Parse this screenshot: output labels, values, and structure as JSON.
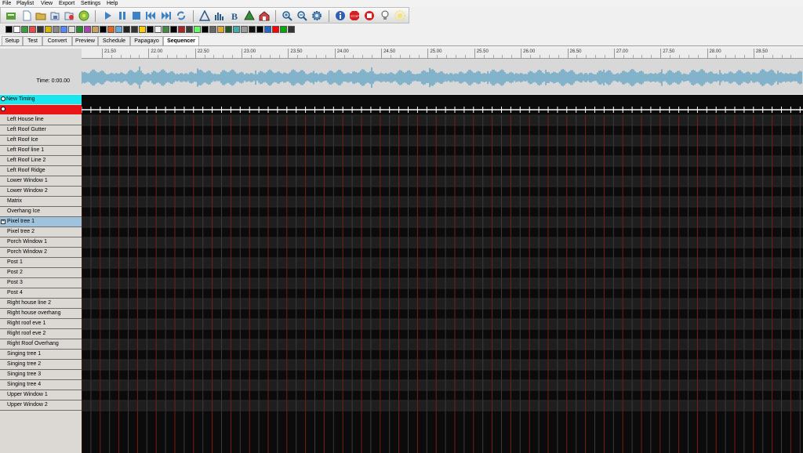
{
  "menu": [
    "File",
    "Playlist",
    "View",
    "Export",
    "Settings",
    "Help"
  ],
  "toolbar": {
    "file_buttons": [
      "new-sequence-icon",
      "new-document-icon",
      "open-folder-icon",
      "save-icon",
      "save-as-icon",
      "render-icon"
    ],
    "playback_buttons": [
      "play-icon",
      "pause-icon",
      "stop-icon",
      "rewind-icon",
      "fast-forward-icon",
      "loop-icon"
    ],
    "tool_buttons": [
      "triangle-icon",
      "bar-chart-icon",
      "bold-b-icon",
      "tree-icon",
      "house-icon"
    ],
    "zoom_buttons": [
      "zoom-in-icon",
      "zoom-out-icon",
      "gear-icon"
    ],
    "status_buttons": [
      "info-icon",
      "stop-sign-icon",
      "record-stop-icon",
      "bulb-icon",
      "sun-icon"
    ]
  },
  "effects_colors": [
    "#000",
    "#fff",
    "#3d9b3d",
    "#e84848",
    "#333",
    "#d4b800",
    "#888",
    "#5588ff",
    "#e0e0e0",
    "#2a8a2a",
    "#aa44aa",
    "#c8a060",
    "#000",
    "#dd6622",
    "#66aadd",
    "#222",
    "#333",
    "#ffcc00",
    "#000",
    "#f0f0f0",
    "#448844",
    "#000",
    "#aa2222",
    "#3a3a3a",
    "#66ff66",
    "#000",
    "#666",
    "#ddaa33",
    "#225522",
    "#4aa",
    "#999",
    "#111",
    "#000",
    "#2266cc",
    "#f00",
    "#0a0",
    "#333"
  ],
  "tabs": [
    "Setup",
    "Test",
    "Convert",
    "Preview",
    "Schedule",
    "Papagayo",
    "Sequencer"
  ],
  "active_tab": "Sequencer",
  "ruler_labels": [
    "21.50",
    "22.00",
    "22.50",
    "23.00",
    "23.50",
    "24.00",
    "24.50",
    "25.00",
    "25.50",
    "26.00",
    "26.50",
    "27.00",
    "27.50",
    "28.00",
    "28.50"
  ],
  "time_label": "Time: 0:00.00",
  "timings": [
    {
      "label": "New Timing",
      "color": "#19e6ec"
    },
    {
      "label": "",
      "color": "#e81616"
    }
  ],
  "models": [
    "Left House line",
    "Left Roof Gutter",
    "Left Roof Ice",
    "Left Roof line 1",
    "Left Roof Line 2",
    "Left Roof Ridge",
    "Lower Window 1",
    "Lower Window 2",
    "Matrix",
    "Overhang Ice",
    "Pixel tree 1",
    "Pixel tree 2",
    "Porch Window 1",
    "Porch Window 2",
    "Post 1",
    "Post 2",
    "Post 3",
    "Post 4",
    "Right house line 2",
    "Right house overhang",
    "Right roof eve 1",
    "Right roof eve 2",
    "Right Roof Overhang",
    "Singing tree 1",
    "Singing tree 2",
    "Singing tree 3",
    "Singing tree 4",
    "Upper Window 1",
    "Upper Window 2"
  ],
  "selected_model": "Pixel tree 1",
  "colors": {
    "grid_bg": "#0b0b0b",
    "grid_line_red": "#7a1e16",
    "grid_line_gray": "#3b3b3b",
    "wave": "#6ea9c8",
    "timing_cyan": "#19e6ec",
    "timing_red": "#e81616",
    "selected_row": "#9fc3dd"
  }
}
